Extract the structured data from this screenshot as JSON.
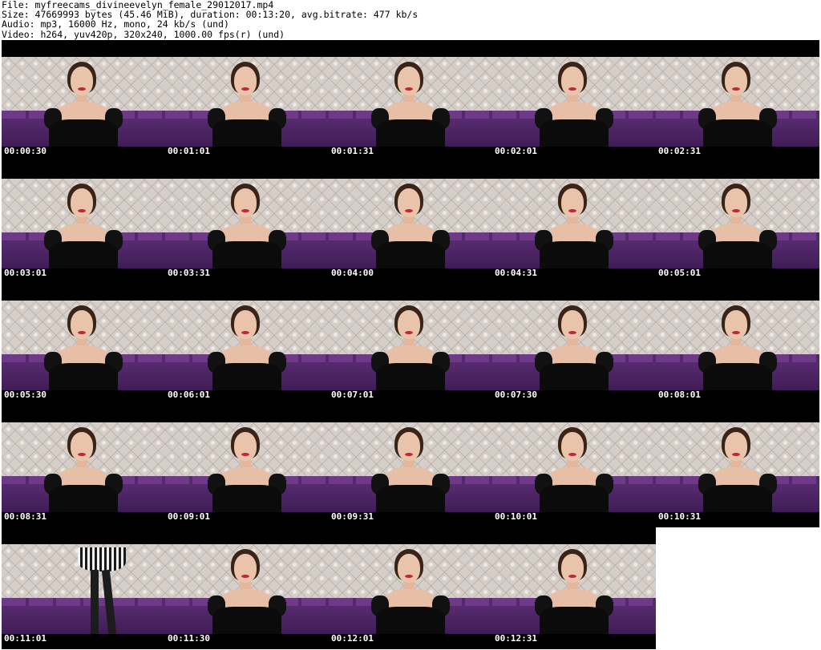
{
  "header": {
    "line1": "File: myfreecams_divineevelyn_female_29012017.mp4",
    "line2": "Size: 47669993 bytes (45.46 MiB), duration: 00:13:20, avg.bitrate: 477 kb/s",
    "line3": "Audio: mp3, 16000 Hz, mono, 24 kb/s (und)",
    "line4": "Video: h264, yuv420p, 320x240, 1000.00 fps(r) (und)"
  },
  "thumbnails": [
    {
      "time": "00:00:30"
    },
    {
      "time": "00:01:01"
    },
    {
      "time": "00:01:31"
    },
    {
      "time": "00:02:01"
    },
    {
      "time": "00:02:31"
    },
    {
      "time": "00:03:01"
    },
    {
      "time": "00:03:31"
    },
    {
      "time": "00:04:00"
    },
    {
      "time": "00:04:31"
    },
    {
      "time": "00:05:01"
    },
    {
      "time": "00:05:30"
    },
    {
      "time": "00:06:01"
    },
    {
      "time": "00:07:01"
    },
    {
      "time": "00:07:30"
    },
    {
      "time": "00:08:01"
    },
    {
      "time": "00:08:31"
    },
    {
      "time": "00:09:01"
    },
    {
      "time": "00:09:31"
    },
    {
      "time": "00:10:01"
    },
    {
      "time": "00:10:31"
    },
    {
      "time": "00:11:01",
      "variant": "legs"
    },
    {
      "time": "00:11:30"
    },
    {
      "time": "00:12:01"
    },
    {
      "time": "00:12:31"
    }
  ]
}
